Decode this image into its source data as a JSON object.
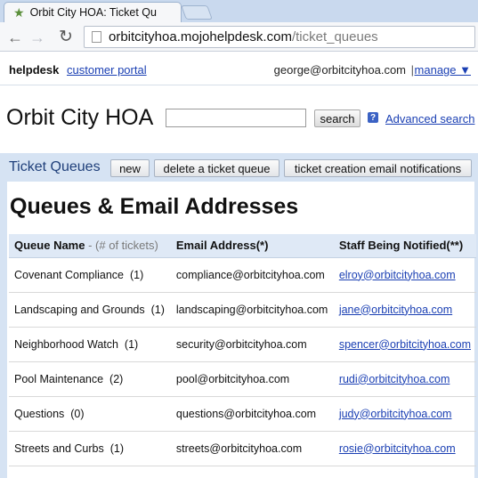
{
  "browser": {
    "tab_title": "Orbit City HOA: Ticket Qu",
    "url_host": "orbitcityhoa.mojohelpdesk.com",
    "url_path": "/ticket_queues",
    "back_icon": "back-arrow-icon",
    "forward_icon": "forward-arrow-icon",
    "reload_icon": "reload-icon"
  },
  "topbar": {
    "brand": "helpdesk",
    "portal_link": "customer portal",
    "user_email": "george@orbitcityhoa.com",
    "separator": "|",
    "manage_link": "manage ▼"
  },
  "header": {
    "title": "Orbit City HOA",
    "search_value": "",
    "search_button": "search",
    "help_icon_glyph": "?",
    "advanced_search": "Advanced search"
  },
  "section": {
    "title": "Ticket Queues",
    "buttons": {
      "new": "new",
      "delete": "delete a ticket queue",
      "notify": "ticket creation email notifications"
    }
  },
  "main": {
    "heading": "Queues & Email Addresses",
    "columns": {
      "queue": "Queue Name",
      "queue_sub": "- (# of tickets)",
      "email": "Email Address(*)",
      "staff": "Staff Being Notified(**)"
    },
    "rows": [
      {
        "name": "Covenant Compliance",
        "count": "(1)",
        "email": "compliance@orbitcityhoa.com",
        "staff": "elroy@orbitcityhoa.com"
      },
      {
        "name": "Landscaping and Grounds",
        "count": "(1)",
        "email": "landscaping@orbitcityhoa.com",
        "staff": "jane@orbitcityhoa.com"
      },
      {
        "name": "Neighborhood Watch",
        "count": "(1)",
        "email": "security@orbitcityhoa.com",
        "staff": "spencer@orbitcityhoa.com"
      },
      {
        "name": "Pool Maintenance",
        "count": "(2)",
        "email": "pool@orbitcityhoa.com",
        "staff": "rudi@orbitcityhoa.com"
      },
      {
        "name": "Questions",
        "count": "(0)",
        "email": "questions@orbitcityhoa.com",
        "staff": "judy@orbitcityhoa.com"
      },
      {
        "name": "Streets and Curbs",
        "count": "(1)",
        "email": "streets@orbitcityhoa.com",
        "staff": "rosie@orbitcityhoa.com"
      }
    ]
  },
  "colors": {
    "link": "#1a3fb3",
    "section_bar": "#d6e3f3",
    "table_header": "#dfe9f6"
  }
}
